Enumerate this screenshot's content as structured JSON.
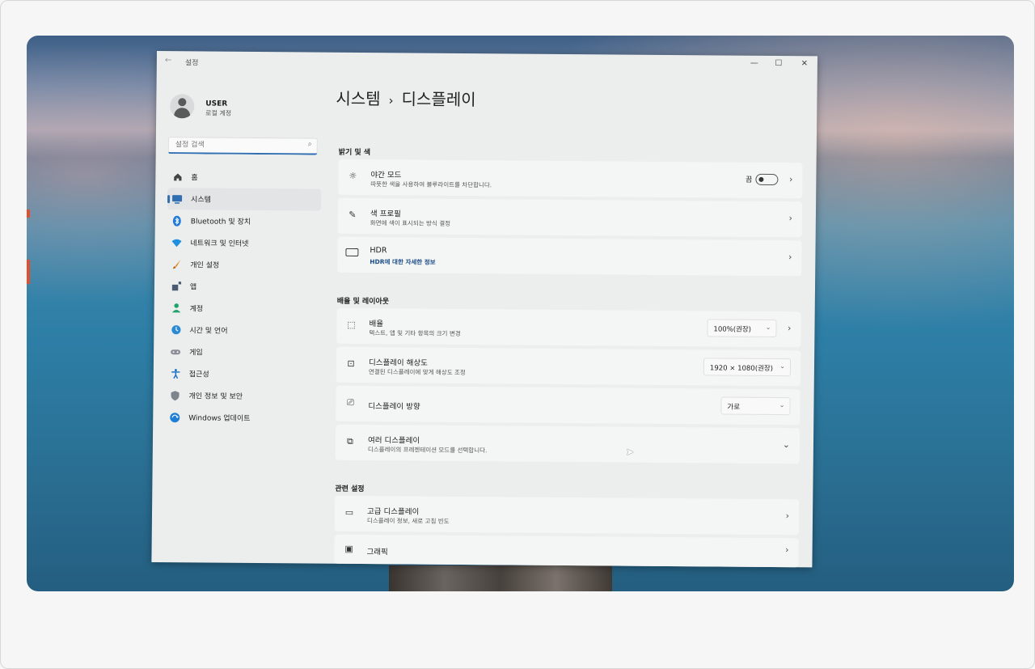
{
  "app": {
    "title": "설정"
  },
  "window_controls": [
    "minimize",
    "maximize",
    "close"
  ],
  "user": {
    "name": "USER",
    "account": "로컬 계정"
  },
  "search": {
    "placeholder": "설정 검색"
  },
  "sidebar": {
    "items": [
      {
        "label": "홈",
        "icon": "home-icon",
        "active": false
      },
      {
        "label": "시스템",
        "icon": "monitor-icon",
        "active": true
      },
      {
        "label": "Bluetooth 및 장치",
        "icon": "bluetooth-icon",
        "active": false
      },
      {
        "label": "네트워크 및 인터넷",
        "icon": "wifi-icon",
        "active": false
      },
      {
        "label": "개인 설정",
        "icon": "brush-icon",
        "active": false
      },
      {
        "label": "앱",
        "icon": "apps-icon",
        "active": false
      },
      {
        "label": "계정",
        "icon": "person-icon",
        "active": false
      },
      {
        "label": "시간 및 언어",
        "icon": "globe-clock-icon",
        "active": false
      },
      {
        "label": "게임",
        "icon": "gamepad-icon",
        "active": false
      },
      {
        "label": "접근성",
        "icon": "accessibility-icon",
        "active": false
      },
      {
        "label": "개인 정보 및 보안",
        "icon": "shield-icon",
        "active": false
      },
      {
        "label": "Windows 업데이트",
        "icon": "update-icon",
        "active": false
      }
    ]
  },
  "breadcrumb": {
    "parent": "시스템",
    "current": "디스플레이"
  },
  "sections": {
    "brightness": {
      "title": "밝기 및 색",
      "night_light": {
        "title": "야간 모드",
        "subtitle": "따뜻한 색을 사용하여 블루라이트를 차단합니다.",
        "toggle_label": "끔",
        "toggle_on": false
      },
      "color_profile": {
        "title": "색 프로필",
        "subtitle": "화면에 색이 표시되는 방식 결정"
      },
      "hdr": {
        "title": "HDR",
        "subtitle": "HDR에 대한 자세한 정보"
      }
    },
    "scale_layout": {
      "title": "배율 및 레이아웃",
      "scale": {
        "title": "배율",
        "subtitle": "텍스트, 앱 및 기타 항목의 크기 변경",
        "value": "100%(권장)"
      },
      "resolution": {
        "title": "디스플레이 해상도",
        "subtitle": "연결된 디스플레이에 맞게 해상도 조정",
        "value": "1920 × 1080(권장)"
      },
      "orientation": {
        "title": "디스플레이 방향",
        "value": "가로"
      },
      "multiple": {
        "title": "여러 디스플레이",
        "subtitle": "디스플레이의 프레젠테이션 모드를 선택합니다."
      }
    },
    "related": {
      "title": "관련 설정",
      "advanced": {
        "title": "고급 디스플레이",
        "subtitle": "디스플레이 정보, 새로 고침 빈도"
      },
      "graphics": {
        "title": "그래픽"
      }
    }
  },
  "colors": {
    "accent": "#2f6fb2",
    "window_bg": "#eceeee",
    "card_bg": "#f4f5f5"
  }
}
